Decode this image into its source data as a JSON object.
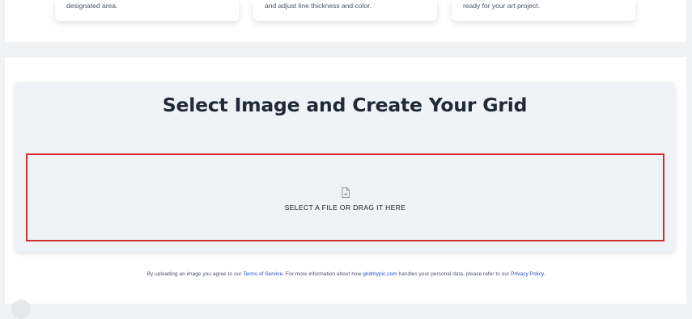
{
  "features": [
    {
      "text": "designated area."
    },
    {
      "text": "and adjust line thickness and color."
    },
    {
      "text": "ready for your art project."
    }
  ],
  "upload": {
    "title": "Select Image and Create Your Grid",
    "dropzone_label": "SELECT A FILE OR DRAG IT HERE",
    "icon": "file-plus-icon",
    "highlight_color": "#d32f2f"
  },
  "consent": {
    "prefix": "By uploading an image you agree to our",
    "terms_link": "Terms of Service",
    "middle": ". For more information about how",
    "site_link": "gridmypic.com",
    "suffix": "handles your personal data, please refer to our",
    "privacy_link": "Privacy Policy",
    "end": "."
  }
}
